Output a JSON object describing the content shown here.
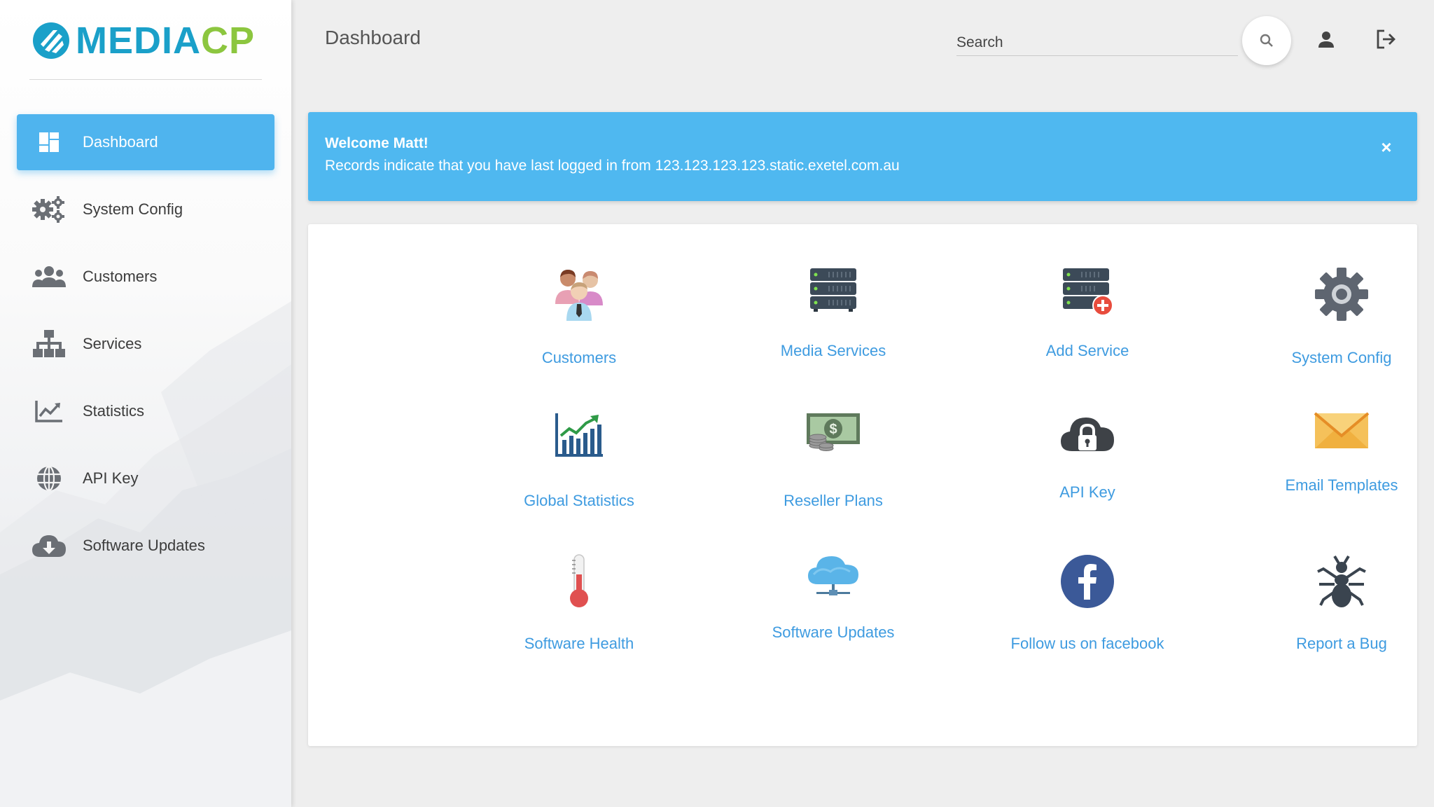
{
  "brand": {
    "logo_part1": "MEDIA",
    "logo_part2": "CP",
    "color_primary": "#1aa0c9",
    "color_secondary": "#8cc63f"
  },
  "sidebar": {
    "items": [
      {
        "label": "Dashboard",
        "icon": "dashboard-icon",
        "active": true
      },
      {
        "label": "System Config",
        "icon": "gears-icon",
        "active": false
      },
      {
        "label": "Customers",
        "icon": "users-icon",
        "active": false
      },
      {
        "label": "Services",
        "icon": "sitemap-icon",
        "active": false
      },
      {
        "label": "Statistics",
        "icon": "line-chart-icon",
        "active": false
      },
      {
        "label": "API Key",
        "icon": "globe-icon",
        "active": false
      },
      {
        "label": "Software Updates",
        "icon": "cloud-download-icon",
        "active": false
      }
    ],
    "active_color": "#4fb4ee"
  },
  "header": {
    "title": "Dashboard",
    "search_placeholder": "Search",
    "search_value": ""
  },
  "alert": {
    "title": "Welcome Matt!",
    "message": "Records indicate that you have last logged in from 123.123.123.123.static.exetel.com.au",
    "close_symbol": "×",
    "color": "#4fb8f0"
  },
  "tiles": [
    {
      "label": "Customers",
      "icon": "customers-group-icon"
    },
    {
      "label": "Media Services",
      "icon": "server-icon"
    },
    {
      "label": "Add Service",
      "icon": "server-add-icon"
    },
    {
      "label": "System Config",
      "icon": "gear-icon"
    },
    {
      "label": "Global Statistics",
      "icon": "bar-chart-icon"
    },
    {
      "label": "Reseller Plans",
      "icon": "money-icon"
    },
    {
      "label": "API Key",
      "icon": "cloud-lock-icon"
    },
    {
      "label": "Email Templates",
      "icon": "envelope-icon"
    },
    {
      "label": "Software Health",
      "icon": "thermometer-icon"
    },
    {
      "label": "Software Updates",
      "icon": "cloud-network-icon"
    },
    {
      "label": "Follow us on facebook",
      "icon": "facebook-icon"
    },
    {
      "label": "Report a Bug",
      "icon": "bug-icon"
    }
  ],
  "tile_label_color": "#3e9be0"
}
